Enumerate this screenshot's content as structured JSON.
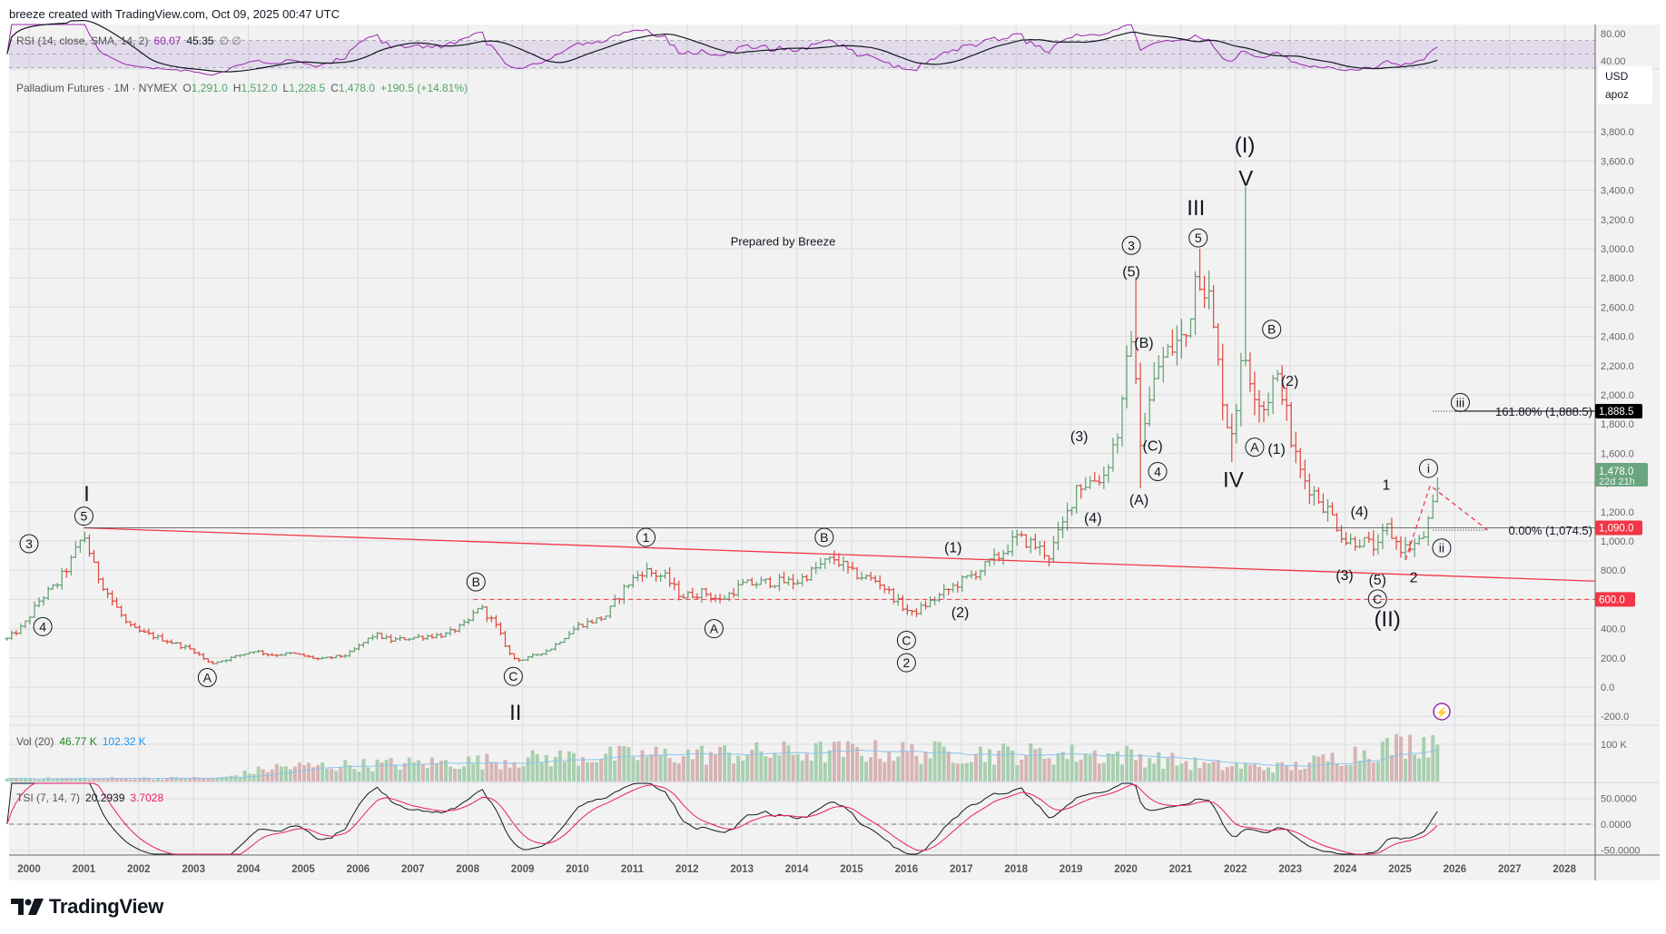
{
  "header": {
    "title": "breeze created with TradingView.com, Oct 09, 2025 00:47 UTC"
  },
  "logo": {
    "text": "TradingView"
  },
  "legend": {
    "symbol": "Palladium Futures · 1M · NYMEX",
    "open_label": "O",
    "open": "1,291.0",
    "high_label": "H",
    "high": "1,512.0",
    "low_label": "L",
    "low": "1,228.5",
    "close_label": "C",
    "close": "1,478.0",
    "change": "+190.5 (+14.81%)"
  },
  "rsi_legend": {
    "label": "RSI (14, close, SMA, 14, 2)",
    "value": "60.07",
    "sma": "45.35",
    "extra": "∅ ∅"
  },
  "vol_legend": {
    "label": "Vol (20)",
    "value": "46.77 K",
    "ma": "102.32 K"
  },
  "tsi_legend": {
    "label": "TSI (7, 14, 7)",
    "value": "20.2939",
    "signal": "3.7028"
  },
  "currency_box": {
    "currency": "USD",
    "unit": "apoz"
  },
  "annotation_text": "Prepared by Breeze",
  "colors": {
    "up": "#5f9f70",
    "down": "#e0473c",
    "rsi": "#9c27b0",
    "tsi_signal": "#e91e63",
    "vol_ma": "#8cc3ea",
    "badge_red": "#f23645",
    "badge_green": "#6aa57f"
  },
  "chart_data": {
    "type": "ohlc",
    "title": "Palladium Futures · 1M · NYMEX",
    "x_ticks": [
      "2000",
      "2001",
      "2002",
      "2003",
      "2004",
      "2005",
      "2006",
      "2007",
      "2008",
      "2009",
      "2010",
      "2011",
      "2012",
      "2013",
      "2014",
      "2015",
      "2016",
      "2017",
      "2018",
      "2019",
      "2020",
      "2021",
      "2022",
      "2023",
      "2024",
      "2025",
      "2026",
      "2027",
      "2028"
    ],
    "price_ticks": [
      "3,800.0",
      "3,600.0",
      "3,400.0",
      "3,200.0",
      "3,000.0",
      "2,800.0",
      "2,600.0",
      "2,400.0",
      "2,200.0",
      "2,000.0",
      "1,800.0",
      "1,600.0",
      "1,400.0",
      "1,200.0",
      "1,000.0",
      "800.0",
      "600.0",
      "400.0",
      "200.0",
      "0.0",
      "-200.0"
    ],
    "price_tick_values": [
      3800,
      3600,
      3400,
      3200,
      3000,
      2800,
      2600,
      2400,
      2200,
      2000,
      1800,
      1600,
      1400,
      1200,
      1000,
      800,
      600,
      400,
      200,
      0,
      -200
    ],
    "rsi_ticks": [
      "80.00",
      "40.00"
    ],
    "vol_ticks": [
      "100 K"
    ],
    "tsi_ticks": [
      "50.0000",
      "0.0000",
      "-50.0000"
    ],
    "close_path": [
      [
        1999.6,
        330
      ],
      [
        1999.9,
        420
      ],
      [
        2000.2,
        600
      ],
      [
        2000.5,
        700
      ],
      [
        2000.75,
        850
      ],
      [
        2001.0,
        1050
      ],
      [
        2001.2,
        800
      ],
      [
        2001.5,
        600
      ],
      [
        2001.8,
        420
      ],
      [
        2002.0,
        380
      ],
      [
        2002.5,
        320
      ],
      [
        2003.0,
        250
      ],
      [
        2003.3,
        160
      ],
      [
        2003.6,
        190
      ],
      [
        2004.1,
        250
      ],
      [
        2004.4,
        220
      ],
      [
        2004.8,
        230
      ],
      [
        2005.3,
        190
      ],
      [
        2005.8,
        220
      ],
      [
        2006.3,
        360
      ],
      [
        2006.6,
        320
      ],
      [
        2007.0,
        340
      ],
      [
        2007.6,
        360
      ],
      [
        2008.0,
        440
      ],
      [
        2008.2,
        560
      ],
      [
        2008.5,
        430
      ],
      [
        2008.8,
        200
      ],
      [
        2009.0,
        185
      ],
      [
        2009.5,
        260
      ],
      [
        2010.0,
        420
      ],
      [
        2010.5,
        480
      ],
      [
        2010.9,
        700
      ],
      [
        2011.2,
        800
      ],
      [
        2011.6,
        750
      ],
      [
        2011.9,
        620
      ],
      [
        2012.3,
        650
      ],
      [
        2012.6,
        590
      ],
      [
        2013.0,
        700
      ],
      [
        2013.5,
        720
      ],
      [
        2014.0,
        720
      ],
      [
        2014.5,
        850
      ],
      [
        2014.7,
        880
      ],
      [
        2015.0,
        780
      ],
      [
        2015.5,
        720
      ],
      [
        2015.9,
        560
      ],
      [
        2016.1,
        500
      ],
      [
        2016.5,
        600
      ],
      [
        2016.9,
        700
      ],
      [
        2017.3,
        790
      ],
      [
        2017.7,
        900
      ],
      [
        2018.0,
        1020
      ],
      [
        2018.3,
        980
      ],
      [
        2018.6,
        900
      ],
      [
        2018.9,
        1150
      ],
      [
        2019.1,
        1380
      ],
      [
        2019.3,
        1400
      ],
      [
        2019.6,
        1450
      ],
      [
        2019.9,
        1800
      ],
      [
        2020.1,
        2450
      ],
      [
        2020.25,
        1700
      ],
      [
        2020.4,
        1900
      ],
      [
        2020.6,
        2200
      ],
      [
        2020.9,
        2350
      ],
      [
        2021.1,
        2400
      ],
      [
        2021.3,
        2900
      ],
      [
        2021.5,
        2700
      ],
      [
        2021.7,
        2150
      ],
      [
        2021.9,
        1700
      ],
      [
        2022.0,
        1900
      ],
      [
        2022.15,
        2300
      ],
      [
        2022.3,
        2100
      ],
      [
        2022.5,
        1900
      ],
      [
        2022.7,
        2100
      ],
      [
        2022.85,
        2050
      ],
      [
        2023.0,
        1700
      ],
      [
        2023.2,
        1450
      ],
      [
        2023.5,
        1300
      ],
      [
        2023.8,
        1150
      ],
      [
        2024.0,
        1000
      ],
      [
        2024.3,
        1000
      ],
      [
        2024.6,
        950
      ],
      [
        2024.75,
        1100
      ],
      [
        2025.0,
        950
      ],
      [
        2025.2,
        960
      ],
      [
        2025.4,
        1000
      ],
      [
        2025.58,
        1200
      ],
      [
        2025.67,
        1291
      ],
      [
        2025.75,
        1478
      ]
    ],
    "extreme_highs": [
      [
        2020.17,
        2800
      ],
      [
        2021.33,
        3000
      ],
      [
        2022.17,
        3425
      ]
    ],
    "extreme_lows": [
      [
        2020.25,
        1360
      ],
      [
        2021.92,
        1540
      ]
    ],
    "last_bar": {
      "open": 1291.0,
      "high": 1512.0,
      "low": 1228.5,
      "close": 1478.0
    },
    "volume_profile": [
      [
        1999.6,
        8000
      ],
      [
        2003.5,
        10000
      ],
      [
        2004.5,
        40000
      ],
      [
        2008.0,
        55000
      ],
      [
        2010.0,
        70000
      ],
      [
        2015.0,
        85000
      ],
      [
        2020.0,
        75000
      ],
      [
        2021.5,
        45000
      ],
      [
        2023.0,
        40000
      ],
      [
        2024.5,
        90000
      ],
      [
        2025.75,
        120000
      ]
    ],
    "trendlines": [
      {
        "kind": "solid-red",
        "from": [
          2001.0,
          1090
        ],
        "to": [
          2028.56,
          725
        ]
      },
      {
        "kind": "horizontal-dark",
        "from": [
          2001.0,
          1090
        ],
        "to": [
          2028.56,
          1090
        ]
      },
      {
        "kind": "dashed-red",
        "from": [
          2008.1,
          600
        ],
        "to": [
          2028.56,
          600
        ]
      },
      {
        "kind": "dotted-dark",
        "from": [
          2025.6,
          1074.5
        ],
        "to": [
          2026.6,
          1074.5
        ]
      },
      {
        "kind": "dotted-dark",
        "from": [
          2025.6,
          1888.5
        ],
        "to": [
          2026.0,
          1888.5
        ]
      },
      {
        "kind": "solid-dark",
        "from": [
          2026.0,
          1888.5
        ],
        "to": [
          2028.56,
          1888.5
        ]
      }
    ],
    "projection": [
      [
        2025.1,
        870
      ],
      [
        2025.55,
        1380
      ],
      [
        2026.6,
        1074.5
      ]
    ],
    "fib_levels": [
      {
        "label": "161.80% (1,888.5)",
        "price": 1888.5
      },
      {
        "label": "0.00% (1,074.5)",
        "price": 1074.5
      }
    ],
    "badges": [
      {
        "text": "1,888.5",
        "price": 1888.5,
        "color": "#000000"
      },
      {
        "text": "1,478.0",
        "sub": "22d 21h",
        "price": 1478,
        "color": "#6aa57f"
      },
      {
        "text": "1,090.0",
        "price": 1090,
        "color": "#f23645"
      },
      {
        "text": "600.0",
        "price": 600,
        "color": "#f23645"
      }
    ],
    "wave_labels": [
      {
        "text": "3",
        "x": 2000.0,
        "y": 981,
        "circled": true
      },
      {
        "text": "4",
        "x": 2000.25,
        "y": 414,
        "circled": true
      },
      {
        "text": "5",
        "x": 2001.0,
        "y": 1170,
        "circled": true
      },
      {
        "text": "I",
        "x": 2001.05,
        "y": 1330,
        "large": true
      },
      {
        "text": "A",
        "x": 2003.25,
        "y": 65,
        "circled": true
      },
      {
        "text": "B",
        "x": 2008.15,
        "y": 720,
        "circled": true
      },
      {
        "text": "C",
        "x": 2008.83,
        "y": 73,
        "circled": true
      },
      {
        "text": "II",
        "x": 2008.87,
        "y": -167,
        "large": true
      },
      {
        "text": "1",
        "x": 2011.25,
        "y": 1025,
        "circled": true
      },
      {
        "text": "A",
        "x": 2012.49,
        "y": 400,
        "circled": true
      },
      {
        "text": "B",
        "x": 2014.5,
        "y": 1025,
        "circled": true
      },
      {
        "text": "C",
        "x": 2016.0,
        "y": 320,
        "circled": true
      },
      {
        "text": "2",
        "x": 2016.0,
        "y": 167,
        "circled": true
      },
      {
        "text": "(1)",
        "x": 2016.85,
        "y": 952
      },
      {
        "text": "(2)",
        "x": 2016.98,
        "y": 509
      },
      {
        "text": "(3)",
        "x": 2019.15,
        "y": 1715
      },
      {
        "text": "(4)",
        "x": 2019.4,
        "y": 1155
      },
      {
        "text": "3",
        "x": 2020.1,
        "y": 3023,
        "circled": true
      },
      {
        "text": "(5)",
        "x": 2020.1,
        "y": 2841
      },
      {
        "text": "(B)",
        "x": 2020.33,
        "y": 2355
      },
      {
        "text": "(C)",
        "x": 2020.49,
        "y": 1650
      },
      {
        "text": "4",
        "x": 2020.58,
        "y": 1475,
        "circled": true
      },
      {
        "text": "(A)",
        "x": 2020.24,
        "y": 1279
      },
      {
        "text": "III",
        "x": 2021.28,
        "y": 3285,
        "large": true
      },
      {
        "text": "5",
        "x": 2021.32,
        "y": 3074,
        "circled": true
      },
      {
        "text": "(I)",
        "x": 2022.17,
        "y": 3714,
        "large": true
      },
      {
        "text": "V",
        "x": 2022.19,
        "y": 3488,
        "large": true
      },
      {
        "text": "IV",
        "x": 2021.96,
        "y": 1424,
        "large": true
      },
      {
        "text": "B",
        "x": 2022.66,
        "y": 2449,
        "circled": true
      },
      {
        "text": "A",
        "x": 2022.35,
        "y": 1642,
        "circled": true
      },
      {
        "text": "(1)",
        "x": 2022.75,
        "y": 1628
      },
      {
        "text": "(2)",
        "x": 2022.99,
        "y": 2093
      },
      {
        "text": "(3)",
        "x": 2023.99,
        "y": 763
      },
      {
        "text": "(4)",
        "x": 2024.26,
        "y": 1199
      },
      {
        "text": "1",
        "x": 2024.75,
        "y": 1381
      },
      {
        "text": "(5)",
        "x": 2024.59,
        "y": 734
      },
      {
        "text": "C",
        "x": 2024.59,
        "y": 603,
        "circled": true
      },
      {
        "text": "(II)",
        "x": 2024.77,
        "y": 472,
        "large": true
      },
      {
        "text": "2",
        "x": 2025.25,
        "y": 749
      },
      {
        "text": "i",
        "x": 2025.52,
        "y": 1497,
        "circled": true
      },
      {
        "text": "ii",
        "x": 2025.76,
        "y": 952,
        "circled": true
      },
      {
        "text": "iii",
        "x": 2026.1,
        "y": 1948,
        "circled": true
      }
    ],
    "annotation": {
      "x": 2013.75,
      "y": 3052
    }
  }
}
